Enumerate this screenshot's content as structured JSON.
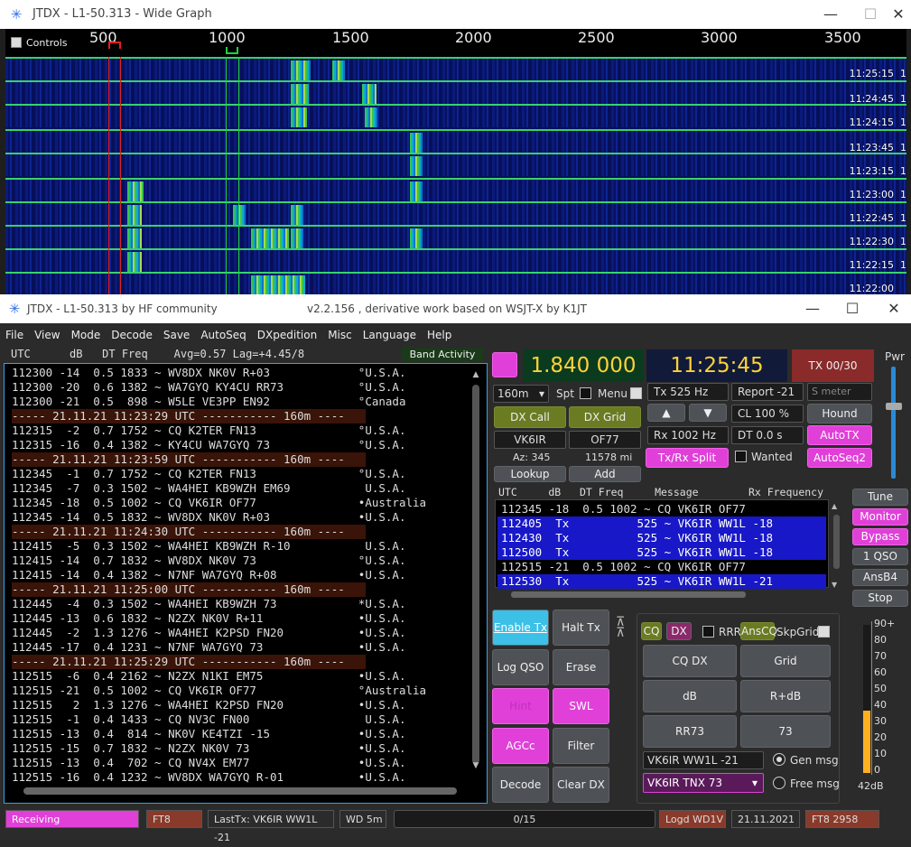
{
  "wide_graph": {
    "title": "JTDX - L1-50.313 - Wide Graph",
    "controls_label": "Controls",
    "scale_labels": [
      "500",
      "1000",
      "1500",
      "2000",
      "2500",
      "3000",
      "3500"
    ],
    "time_labels": [
      "11:25:15",
      "11:24:45",
      "11:24:15",
      "11:23:45",
      "11:23:15",
      "11:23:00",
      "11:22:45",
      "11:22:30",
      "11:22:15",
      "11:22:00"
    ],
    "row_suffix": "1"
  },
  "main": {
    "title": "JTDX - L1-50.313  by HF community",
    "subtitle": "v2.2.156 , derivative work based on WSJT-X by K1JT",
    "menu": [
      "File",
      "View",
      "Mode",
      "Decode",
      "Save",
      "AutoSeq",
      "DXpedition",
      "Misc",
      "Language",
      "Help"
    ],
    "band_header": "UTC      dB   DT Freq    Avg=0.57 Lag=+4.45/8",
    "band_activity_label": "Band Activity",
    "decodes": [
      {
        "t": "112300 -14  0.5 1833 ~ WV8DX NK0V R+03             °U.S.A.",
        "sep": false
      },
      {
        "t": "112300 -20  0.6 1382 ~ WA7GYQ KY4CU RR73           °U.S.A.",
        "sep": false
      },
      {
        "t": "112300 -21  0.5  898 ~ W5LE VE3PP EN92             °Canada",
        "sep": false
      },
      {
        "t": "----- 21.11.21 11:23:29 UTC ----------- 160m ----",
        "sep": true
      },
      {
        "t": "112315  -2  0.7 1752 ~ CQ K2TER FN13               °U.S.A.",
        "sep": false
      },
      {
        "t": "112315 -16  0.4 1382 ~ KY4CU WA7GYQ 73             °U.S.A.",
        "sep": false
      },
      {
        "t": "----- 21.11.21 11:23:59 UTC ----------- 160m ----",
        "sep": true
      },
      {
        "t": "112345  -1  0.7 1752 ~ CQ K2TER FN13               °U.S.A.",
        "sep": false
      },
      {
        "t": "112345  -7  0.3 1502 ~ WA4HEI KB9WZH EM69           U.S.A.",
        "sep": false
      },
      {
        "t": "112345 -18  0.5 1002 ~ CQ VK6IR OF77               •Australia",
        "sep": false
      },
      {
        "t": "112345 -14  0.5 1832 ~ WV8DX NK0V R+03             •U.S.A.",
        "sep": false
      },
      {
        "t": "----- 21.11.21 11:24:30 UTC ----------- 160m ----",
        "sep": true
      },
      {
        "t": "112415  -5  0.3 1502 ~ WA4HEI KB9WZH R-10           U.S.A.",
        "sep": false
      },
      {
        "t": "112415 -14  0.7 1832 ~ WV8DX NK0V 73               °U.S.A.",
        "sep": false
      },
      {
        "t": "112415 -14  0.4 1382 ~ N7NF WA7GYQ R+08            •U.S.A.",
        "sep": false
      },
      {
        "t": "----- 21.11.21 11:25:00 UTC ----------- 160m ----",
        "sep": true
      },
      {
        "t": "112445  -4  0.3 1502 ~ WA4HEI KB9WZH 73            *U.S.A.",
        "sep": false
      },
      {
        "t": "112445 -13  0.6 1832 ~ N2ZX NK0V R+11              •U.S.A.",
        "sep": false
      },
      {
        "t": "112445  -2  1.3 1276 ~ WA4HEI K2PSD FN20           •U.S.A.",
        "sep": false
      },
      {
        "t": "112445 -17  0.4 1231 ~ N7NF WA7GYQ 73              •U.S.A.",
        "sep": false
      },
      {
        "t": "----- 21.11.21 11:25:29 UTC ----------- 160m ----",
        "sep": true
      },
      {
        "t": "112515  -6  0.4 2162 ~ N2ZX N1KI EM75              •U.S.A.",
        "sep": false
      },
      {
        "t": "112515 -21  0.5 1002 ~ CQ VK6IR OF77               °Australia",
        "sep": false
      },
      {
        "t": "112515   2  1.3 1276 ~ WA4HEI K2PSD FN20           •U.S.A.",
        "sep": false
      },
      {
        "t": "112515  -1  0.4 1433 ~ CQ NV3C FN00                 U.S.A.",
        "sep": false
      },
      {
        "t": "112515 -13  0.4  814 ~ NK0V KE4TZI -15             •U.S.A.",
        "sep": false
      },
      {
        "t": "112515 -15  0.7 1832 ~ N2ZX NK0V 73                •U.S.A.",
        "sep": false
      },
      {
        "t": "112515 -13  0.4  702 ~ CQ NV4X EM77                •U.S.A.",
        "sep": false
      },
      {
        "t": "112515 -16  0.4 1232 ~ WV8DX WA7GYQ R-01           •U.S.A.",
        "sep": false
      }
    ],
    "freq_display": "1.840 000",
    "clock": "11:25:45",
    "tx_counter": "TX 00/30",
    "band": "160m",
    "spt": "Spt",
    "menu_chk": "Menu",
    "tx_hz": "Tx  525 Hz",
    "rx_hz": "Rx  1002 Hz",
    "report": "Report -21",
    "s_meter": "S meter",
    "cl": "CL  100 %",
    "dt": "DT 0.0 s",
    "hound": "Hound",
    "autotx": "AutoTX",
    "autoseq2": "AutoSeq2",
    "dx_call_btn": "DX Call",
    "dx_grid_btn": "DX Grid",
    "dx_call": "VK6IR",
    "dx_grid": "OF77",
    "az": "Az: 345",
    "dist": "11578 mi",
    "lookup": "Lookup",
    "add": "Add",
    "split": "Tx/Rx Split",
    "wanted": "Wanted",
    "up": "▲",
    "down": "▼",
    "rx_header": "UTC     dB   DT Freq     Message        Rx Frequency",
    "rx_lines": [
      {
        "t": "112345 -18  0.5 1002 ~ CQ VK6IR OF77",
        "tx": false
      },
      {
        "t": "112405  Tx          525 ~ VK6IR WW1L -18",
        "tx": true
      },
      {
        "t": "112430  Tx          525 ~ VK6IR WW1L -18",
        "tx": true
      },
      {
        "t": "112500  Tx          525 ~ VK6IR WW1L -18",
        "tx": true
      },
      {
        "t": "112515 -21  0.5 1002 ~ CQ VK6IR OF77",
        "tx": false
      },
      {
        "t": "112530  Tx          525 ~ VK6IR WW1L -21",
        "tx": true
      }
    ],
    "side_btns": [
      "Tune",
      "Monitor",
      "Bypass",
      "1 QSO",
      "AnsB4",
      "Stop"
    ],
    "pwr": "Pwr",
    "enable_tx": "Enable Tx",
    "halt_tx": "Halt Tx",
    "log_qso": "Log QSO",
    "erase": "Erase",
    "hint": "Hint",
    "swl": "SWL mode",
    "agcc": "AGCc",
    "filter": "Filter",
    "decode": "Decode",
    "clear_dx": "Clear DX",
    "cq": "CQ",
    "dx": "DX",
    "rrr": "RRR",
    "anscq": "AnsCQ",
    "skpgrid": "SkpGrid",
    "msg_btns": [
      "CQ DX",
      "Grid",
      "dB",
      "R+dB",
      "RR73",
      "73"
    ],
    "gen_msg_text": "VK6IR WW1L -21",
    "free_msg_text": "VK6IR TNX 73",
    "gen_msg": "Gen msg",
    "free_msg": "Free msg",
    "meter_labels": [
      "90+",
      "80",
      "70",
      "60",
      "50",
      "40",
      "30",
      "20",
      "10",
      "0"
    ],
    "meter_value": "42dB",
    "meter_level": 0.42
  },
  "status": {
    "receiving": "Receiving",
    "mode": "FT8",
    "last_tx": "LastTx: VK6IR WW1L -21",
    "wd": "WD 5m",
    "progress": "0/15",
    "logd": "Logd WD1V",
    "date": "21.11.2021",
    "ft8_code": "FT8  2958"
  },
  "colors": {
    "accent": "#e040d8",
    "freq_bg": "#0b3b1e",
    "tx_row": "#1818c8"
  }
}
